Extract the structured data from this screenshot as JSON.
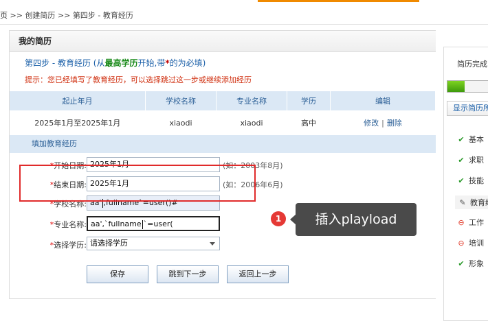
{
  "breadcrumb": {
    "home": "页",
    "sep1": ">>",
    "item1": "创建简历",
    "sep2": ">>",
    "item2": "第四步 - 教育经历"
  },
  "main": {
    "title": "我的简历",
    "step_title": "第四步 - 教育经历",
    "step_sub_open": "(从",
    "step_sub_bold": "最高学历",
    "step_sub_mid": "开始,带",
    "step_sub_star": "*",
    "step_sub_end": "的为必填)",
    "hint": "提示：您已经填写了教育经历，可以选择跳过这一步或继续添加经历"
  },
  "table": {
    "headers": [
      "起止年月",
      "学校名称",
      "专业名称",
      "学历",
      "编辑"
    ],
    "rows": [
      {
        "period": "2025年1月至2025年1月",
        "school": "xiaodi",
        "major": "xiaodi",
        "degree": "高中",
        "edit": "修改",
        "sep": "|",
        "delete": "删除"
      }
    ]
  },
  "form": {
    "section_title": "填加教育经历",
    "start_label": "开始日期:",
    "start_value": "2025年1月",
    "start_example": "(如：2003年8月)",
    "end_label": "结束日期:",
    "end_value": "2025年1月",
    "end_example": "(如：2006年6月)",
    "school_label": "学校名称:",
    "school_value_a": "aa'",
    "school_value_b": ",fullname`=user()#",
    "major_label": "专业名称:",
    "major_value_a": "aa',`fullname",
    "major_value_b": "`=user(",
    "degree_label": "选择学历:",
    "degree_value": "请选择学历",
    "required_mark": "*",
    "save_label": "保存",
    "next_label": "跳到下一步",
    "back_label": "返回上一步"
  },
  "annotation": {
    "number": "1",
    "text": "插入playload",
    "box_color": "#e02a2a",
    "badge_color": "#e53935"
  },
  "sidebar": {
    "title": "简历完成",
    "progress_fraction": 0.4,
    "show_button": "显示简历所",
    "items": [
      {
        "label": "基本",
        "icon": "check-icon",
        "status": "done"
      },
      {
        "label": "求职",
        "icon": "check-icon",
        "status": "done"
      },
      {
        "label": "技能",
        "icon": "check-icon",
        "status": "done"
      },
      {
        "label": "教育经",
        "icon": "pencil-icon",
        "status": "current"
      },
      {
        "label": "工作",
        "icon": "minus-circle-icon",
        "status": "empty"
      },
      {
        "label": "培训",
        "icon": "minus-circle-icon",
        "status": "empty"
      },
      {
        "label": "形象",
        "icon": "check-icon",
        "status": "done"
      }
    ]
  },
  "colors": {
    "accent": "#f08a00",
    "link_blue": "#1a5fa8",
    "header_bg": "#dbe8f5",
    "required_red": "#e00000"
  }
}
